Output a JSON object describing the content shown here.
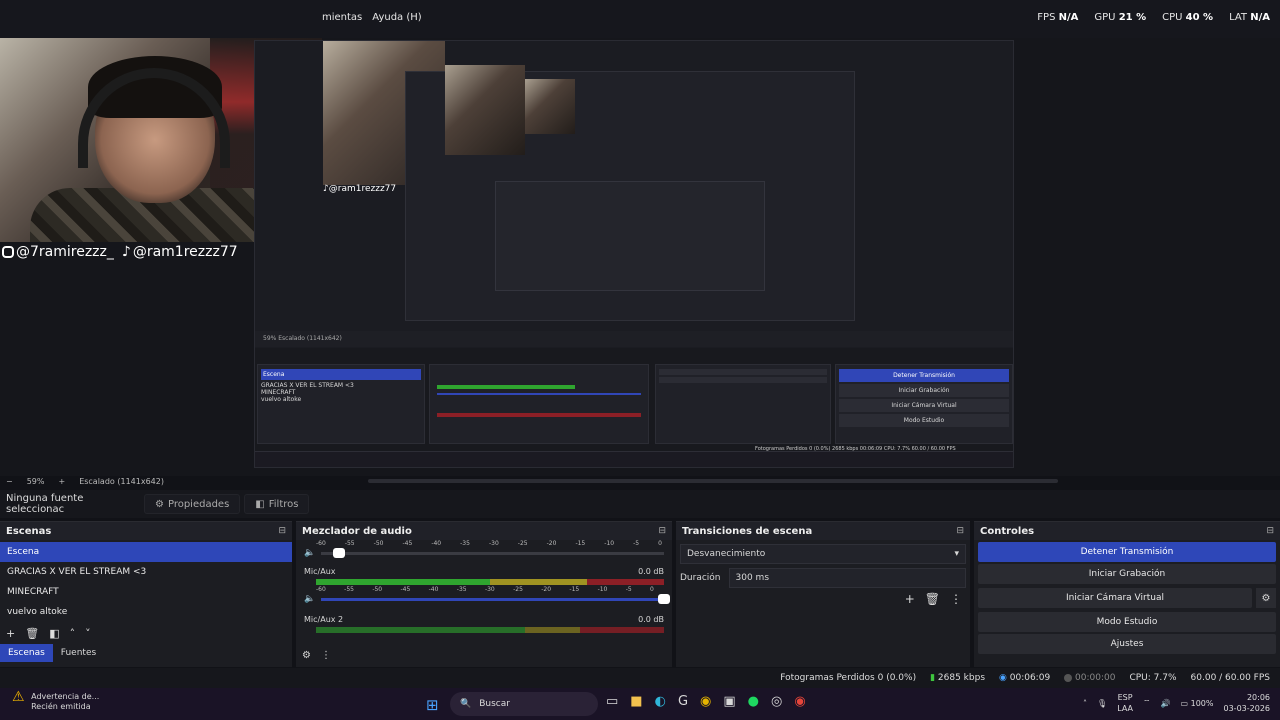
{
  "menubar": {
    "visible_menus": [
      "mientas",
      "Ayuda (H)"
    ],
    "stats": [
      {
        "label": "FPS",
        "value": "N/A"
      },
      {
        "label": "GPU",
        "value": "21 %"
      },
      {
        "label": "CPU",
        "value": "40 %"
      },
      {
        "label": "LAT",
        "value": "N/A"
      }
    ]
  },
  "preview": {
    "social_instagram": "@7ramirezzz_",
    "social_tiktok": "@ram1rezzz77",
    "nested_tiktok": "@ram1rezzz77",
    "nested_handle_small": "@ram1rezzz77",
    "nested_scenes": [
      "Escena",
      "GRACIAS X VER EL STREAM <3",
      "MINECRAFT",
      "vuelvo altoke"
    ],
    "nested_controls": [
      "Detener Transmisión",
      "Iniciar Grabación",
      "Iniciar Cámara Virtual",
      "Modo Estudio",
      "Ajustes"
    ],
    "nested_status": "Fotogramas Perdidos 0 (0.0%)   2685 kbps   00:06:09   CPU: 7.7%   60.00 / 60.00 FPS",
    "nested_zoom": "59%   Escalado (1141x642)"
  },
  "zoombar": {
    "minus": "−",
    "zoom": "59%",
    "plus": "+",
    "scaled": "Escalado (1141x642)"
  },
  "source_toolbar": {
    "no_source": "Ninguna fuente seleccionac",
    "properties": "Propiedades",
    "filters": "Filtros"
  },
  "scenes_dock": {
    "title": "Escenas",
    "items": [
      "Escena",
      "GRACIAS X VER EL STREAM <3",
      "MINECRAFT",
      "vuelvo altoke"
    ],
    "active_index": 0,
    "tabs": [
      "Escenas",
      "Fuentes"
    ]
  },
  "mixer_dock": {
    "title": "Mezclador de audio",
    "scale": [
      "-60",
      "-55",
      "-50",
      "-45",
      "-40",
      "-35",
      "-30",
      "-25",
      "-20",
      "-15",
      "-10",
      "-5",
      "0"
    ],
    "channels": [
      {
        "name": "Mic/Aux",
        "db": "0.0 dB",
        "level": 0.72
      },
      {
        "name": "Mic/Aux 2",
        "db": "0.0 dB",
        "level": 0.0
      }
    ]
  },
  "transitions_dock": {
    "title": "Transiciones de escena",
    "selected": "Desvanecimiento",
    "duration_label": "Duración",
    "duration_value": "300 ms"
  },
  "controls_dock": {
    "title": "Controles",
    "stop_stream": "Detener Transmisión",
    "start_recording": "Iniciar Grabación",
    "start_virtual_cam": "Iniciar Cámara Virtual",
    "studio_mode": "Modo Estudio",
    "settings": "Ajustes"
  },
  "statusbar": {
    "dropped_frames": "Fotogramas Perdidos 0 (0.0%)",
    "bitrate": "2685 kbps",
    "stream_time": "00:06:09",
    "record_time": "00:00:00",
    "cpu": "CPU: 7.7%",
    "fps": "60.00 / 60.00 FPS"
  },
  "taskbar": {
    "notification_title": "Advertencia de...",
    "notification_sub": "Recién emitida",
    "search_placeholder": "Buscar",
    "lang_top": "ESP",
    "lang_bottom": "LAA",
    "battery": "100%",
    "time": "20:06",
    "date": "03-03-2026"
  },
  "colors": {
    "accent": "#2e47b8",
    "meter_green": "#2fa52f",
    "meter_yellow": "#a09322",
    "meter_red": "#8c1f26"
  }
}
